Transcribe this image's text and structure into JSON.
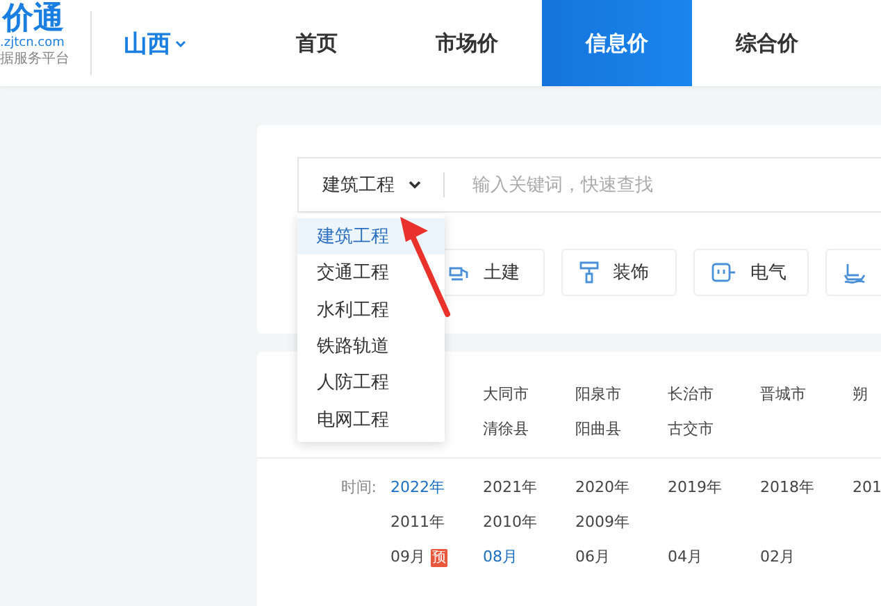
{
  "logo": {
    "mark": "价通",
    "domain": ".zjtcn.com",
    "tagline": "据服务平台"
  },
  "region": {
    "label": "山西"
  },
  "nav": [
    {
      "label": "首页",
      "selected": false
    },
    {
      "label": "市场价",
      "selected": false
    },
    {
      "label": "信息价",
      "selected": true
    },
    {
      "label": "综合价",
      "selected": false
    }
  ],
  "search": {
    "category": "建筑工程",
    "placeholder": "输入关键词，快速查找"
  },
  "category_menu": [
    {
      "label": "建筑工程",
      "selected": true
    },
    {
      "label": "交通工程",
      "selected": false
    },
    {
      "label": "水利工程",
      "selected": false
    },
    {
      "label": "铁路轨道",
      "selected": false
    },
    {
      "label": "人防工程",
      "selected": false
    },
    {
      "label": "电网工程",
      "selected": false
    }
  ],
  "categories": [
    {
      "kind": "civil",
      "label": "土建"
    },
    {
      "kind": "decor",
      "label": "装饰"
    },
    {
      "kind": "electric",
      "label": "电气"
    },
    {
      "kind": "water"
    }
  ],
  "cities": [
    [
      "大同市",
      "阳泉市",
      "长治市",
      "晋城市",
      "朔"
    ],
    [
      "清徐县",
      "阳曲县",
      "古交市"
    ]
  ],
  "time": {
    "label": "时间:",
    "years": [
      {
        "label": "2022年",
        "selected": true
      },
      {
        "label": "2021年",
        "selected": false
      },
      {
        "label": "2020年",
        "selected": false
      },
      {
        "label": "2019年",
        "selected": false
      },
      {
        "label": "2018年",
        "selected": false
      },
      {
        "label": "201",
        "selected": false
      },
      {
        "label": "2011年",
        "selected": false
      },
      {
        "label": "2010年",
        "selected": false
      },
      {
        "label": "2009年",
        "selected": false
      }
    ],
    "months": [
      {
        "label": "09月",
        "selected": false,
        "badge": "预"
      },
      {
        "label": "08月",
        "selected": true
      },
      {
        "label": "06月",
        "selected": false
      },
      {
        "label": "04月",
        "selected": false
      },
      {
        "label": "02月",
        "selected": false
      }
    ]
  }
}
